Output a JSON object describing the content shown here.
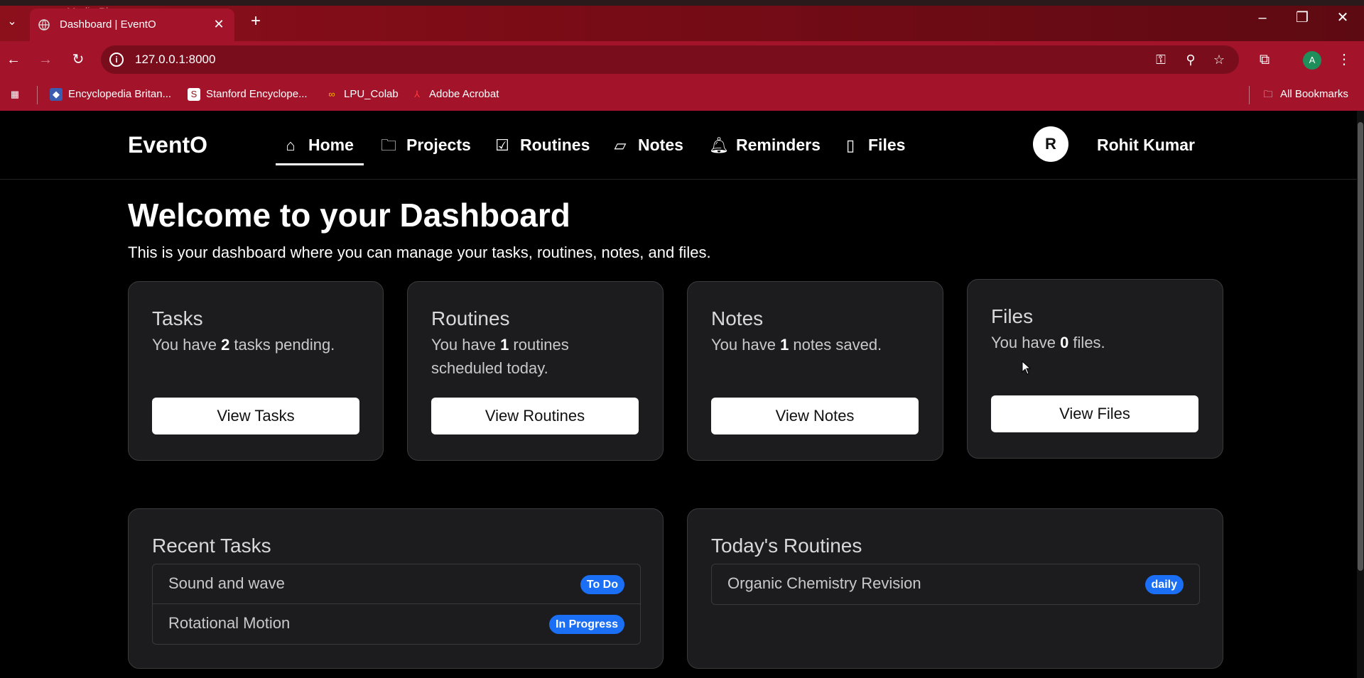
{
  "browser": {
    "ghost_tab": "Media Player",
    "active_tab_title": "Dashboard | EventO",
    "url": "127.0.0.1:8000",
    "profile_initial": "A",
    "bookmarks": [
      {
        "label": "Encyclopedia Britan..."
      },
      {
        "label": "Stanford Encyclope..."
      },
      {
        "label": "LPU_Colab"
      },
      {
        "label": "Adobe Acrobat"
      }
    ],
    "all_bookmarks": "All Bookmarks"
  },
  "nav": {
    "brand": "EventO",
    "items": [
      {
        "label": "Home",
        "icon": "home-icon"
      },
      {
        "label": "Projects",
        "icon": "folder-icon"
      },
      {
        "label": "Routines",
        "icon": "calendar-check-icon"
      },
      {
        "label": "Notes",
        "icon": "sticky-note-icon"
      },
      {
        "label": "Reminders",
        "icon": "bell-icon"
      },
      {
        "label": "Files",
        "icon": "file-icon"
      }
    ],
    "active": "Home",
    "avatar_initial": "R",
    "user_name": "Rohit Kumar"
  },
  "dashboard": {
    "title": "Welcome to your Dashboard",
    "subtitle": "This is your dashboard where you can manage your tasks, routines, notes, and files."
  },
  "cards": [
    {
      "title": "Tasks",
      "pre": "You have ",
      "count": "2",
      "post": " tasks pending.",
      "button": "View Tasks"
    },
    {
      "title": "Routines",
      "pre": "You have ",
      "count": "1",
      "post": " routines scheduled today.",
      "button": "View Routines"
    },
    {
      "title": "Notes",
      "pre": "You have ",
      "count": "1",
      "post": " notes saved.",
      "button": "View Notes"
    },
    {
      "title": "Files",
      "pre": "You have ",
      "count": "0",
      "post": " files.",
      "button": "View Files"
    }
  ],
  "recent_tasks": {
    "title": "Recent Tasks",
    "items": [
      {
        "name": "Sound and wave",
        "status": "To Do"
      },
      {
        "name": "Rotational Motion",
        "status": "In Progress"
      }
    ]
  },
  "todays_routines": {
    "title": "Today's Routines",
    "items": [
      {
        "name": "Organic Chemistry Revision",
        "frequency": "daily"
      }
    ]
  },
  "colors": {
    "chrome": "#a3142a",
    "page_bg": "#000000",
    "card_bg": "#1c1c1e",
    "badge": "#1a6ff5"
  }
}
